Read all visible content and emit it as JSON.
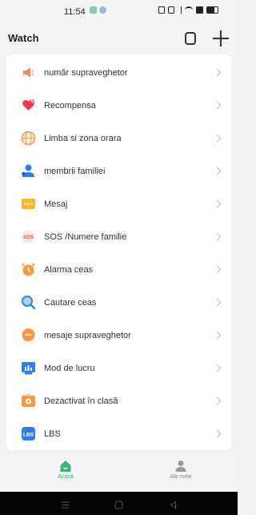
{
  "status_bar": {
    "time": "11:54"
  },
  "header": {
    "title": "Watch"
  },
  "menu": {
    "items": [
      {
        "label": "număr supraveghetor",
        "icon": "speaker-icon",
        "color": "#f08a5d"
      },
      {
        "label": "Recompensa",
        "icon": "heart-icon",
        "color": "#e53950"
      },
      {
        "label": "Limba si zona orara",
        "icon": "globe-icon",
        "color": "#f5a04a"
      },
      {
        "label": "membrii familiei",
        "icon": "family-icon",
        "color": "#2f7df6"
      },
      {
        "label": "Mesaj",
        "icon": "message-icon",
        "color": "#f7b733"
      },
      {
        "label": "SOS /Numere familie",
        "icon": "sos-icon",
        "color": "#e8464c"
      },
      {
        "label": "Alarma ceas",
        "icon": "alarm-icon",
        "color": "#f39c3f"
      },
      {
        "label": "Cautare ceas",
        "icon": "search-icon",
        "color": "#2f8be8"
      },
      {
        "label": "mesaje supraveghetor",
        "icon": "chat-icon",
        "color": "#f39c3f"
      },
      {
        "label": "Mod de lucru",
        "icon": "work-mode-icon",
        "color": "#2f7df6"
      },
      {
        "label": "Dezactivat în clasă",
        "icon": "class-disable-icon",
        "color": "#f39c3f"
      },
      {
        "label": "LBS",
        "icon": "lbs-icon",
        "color": "#2f7df6"
      }
    ]
  },
  "sos_text": "SOS",
  "lbs_text": "LBS",
  "bottom_nav": {
    "home_label": "Acasă",
    "mine_label": "Ale mele",
    "active_color": "#3cb371",
    "inactive_color": "#999999"
  }
}
